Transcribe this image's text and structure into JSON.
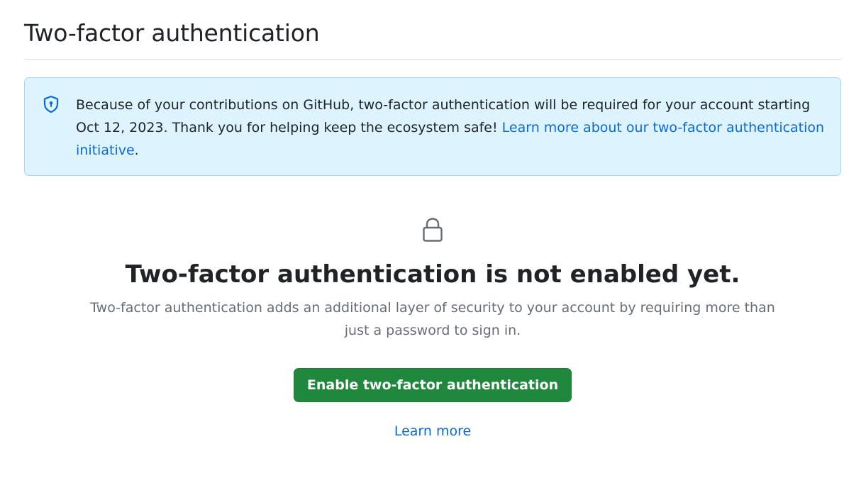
{
  "header": {
    "title": "Two-factor authentication"
  },
  "notice": {
    "icon": "shield-icon",
    "text": "Because of your contributions on GitHub, two-factor authentication will be required for your account starting Oct 12, 2023. Thank you for helping keep the ecosystem safe! ",
    "link_label": "Learn more about our two-factor authentication initiative",
    "trailing": "."
  },
  "empty_state": {
    "icon": "lock-icon",
    "heading": "Two-factor authentication is not enabled yet.",
    "description": "Two-factor authentication adds an additional layer of security to your account by requiring more than just a password to sign in.",
    "enable_button_label": "Enable two-factor authentication",
    "learn_more_label": "Learn more"
  },
  "colors": {
    "accent_blue": "#0969da",
    "notice_background": "#ddf4ff",
    "primary_button": "#1f883d",
    "muted_text": "#656d76"
  }
}
